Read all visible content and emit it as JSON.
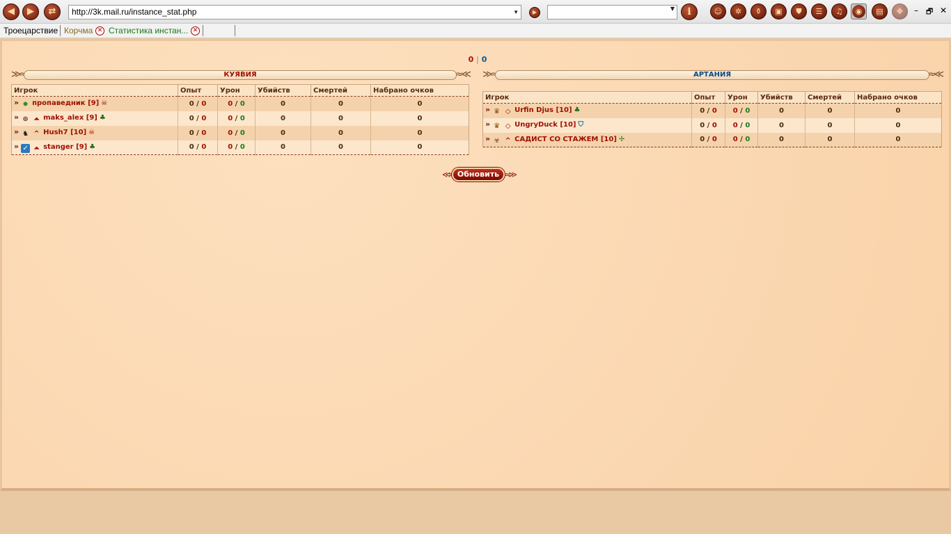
{
  "browser": {
    "url": "http://3k.mail.ru/instance_stat.php",
    "search_value": "",
    "nav_back": "back-arrow",
    "nav_forward": "forward-arrow",
    "nav_reload": "reload-arrows",
    "info_label": "i",
    "tool_icons": [
      "character-icon",
      "skills-icon",
      "bottle-icon",
      "computer-icon",
      "shield-icon",
      "scroll-icon",
      "bell-icon",
      "camera-icon",
      "film-icon",
      "map-icon"
    ],
    "window_controls": {
      "minimize": "–",
      "restore": "🗗",
      "close": "✕"
    }
  },
  "tabs": [
    {
      "label": "Троецарствие",
      "closable": false,
      "color": "#000000"
    },
    {
      "label": "Корчма",
      "closable": true,
      "color": "#8a6a1a"
    },
    {
      "label": "Статистика инстан...",
      "closable": true,
      "color": "#1a7a1a"
    },
    {
      "label": "",
      "closable": false,
      "color": "#000000"
    }
  ],
  "score": {
    "left": "0",
    "separator": "|",
    "right": "0"
  },
  "columns": [
    "Игрок",
    "Опыт",
    "Урон",
    "Убийств",
    "Смертей",
    "Набрано очков"
  ],
  "teams": [
    {
      "name": "КУЯВИЯ",
      "color": "#a01000",
      "players": [
        {
          "icon": "green-star-icon",
          "rank": "",
          "name": "пропаведник [9]",
          "badge": "skull-icon",
          "exp_a": "0",
          "exp_b": "0",
          "dmg_a": "0",
          "dmg_b": "0",
          "kills": "0",
          "deaths": "0",
          "points": "0"
        },
        {
          "icon": "wheel-icon",
          "rank": "double-chevron-rank-icon",
          "name": "maks_alex [9]",
          "badge": "palm-icon",
          "exp_a": "0",
          "exp_b": "0",
          "dmg_a": "0",
          "dmg_b": "0",
          "kills": "0",
          "deaths": "0",
          "points": "0"
        },
        {
          "icon": "horseman-icon",
          "rank": "chevron-rank-icon",
          "name": "Hush7 [10]",
          "badge": "skull-icon",
          "exp_a": "0",
          "exp_b": "0",
          "dmg_a": "0",
          "dmg_b": "0",
          "kills": "0",
          "deaths": "0",
          "points": "0"
        },
        {
          "icon": "blue-check-icon",
          "rank": "double-chevron-rank-icon",
          "name": "stanger [9]",
          "badge": "palm-icon",
          "exp_a": "0",
          "exp_b": "0",
          "dmg_a": "0",
          "dmg_b": "0",
          "kills": "0",
          "deaths": "0",
          "points": "0"
        }
      ]
    },
    {
      "name": "АРТАНИЯ",
      "color": "#0a4a8a",
      "players": [
        {
          "icon": "crown-icon",
          "rank": "diamond-rank-icon",
          "name": "Urfin Djus [10]",
          "badge": "palm-icon",
          "exp_a": "0",
          "exp_b": "0",
          "dmg_a": "0",
          "dmg_b": "0",
          "kills": "0",
          "deaths": "0",
          "points": "0"
        },
        {
          "icon": "crown-icon",
          "rank": "diamond-rank-icon",
          "name": "UngryDuck [10]",
          "badge": "blue-shield-icon",
          "exp_a": "0",
          "exp_b": "0",
          "dmg_a": "0",
          "dmg_b": "0",
          "kills": "0",
          "deaths": "0",
          "points": "0"
        },
        {
          "icon": "mask-icon",
          "rank": "chevron-rank-icon",
          "name": "САДИСТ СО СТАЖЕМ [10]",
          "badge": "green-cross-icon",
          "exp_a": "0",
          "exp_b": "0",
          "dmg_a": "0",
          "dmg_b": "0",
          "kills": "0",
          "deaths": "0",
          "points": "0"
        }
      ]
    }
  ],
  "refresh_label": "Обновить"
}
